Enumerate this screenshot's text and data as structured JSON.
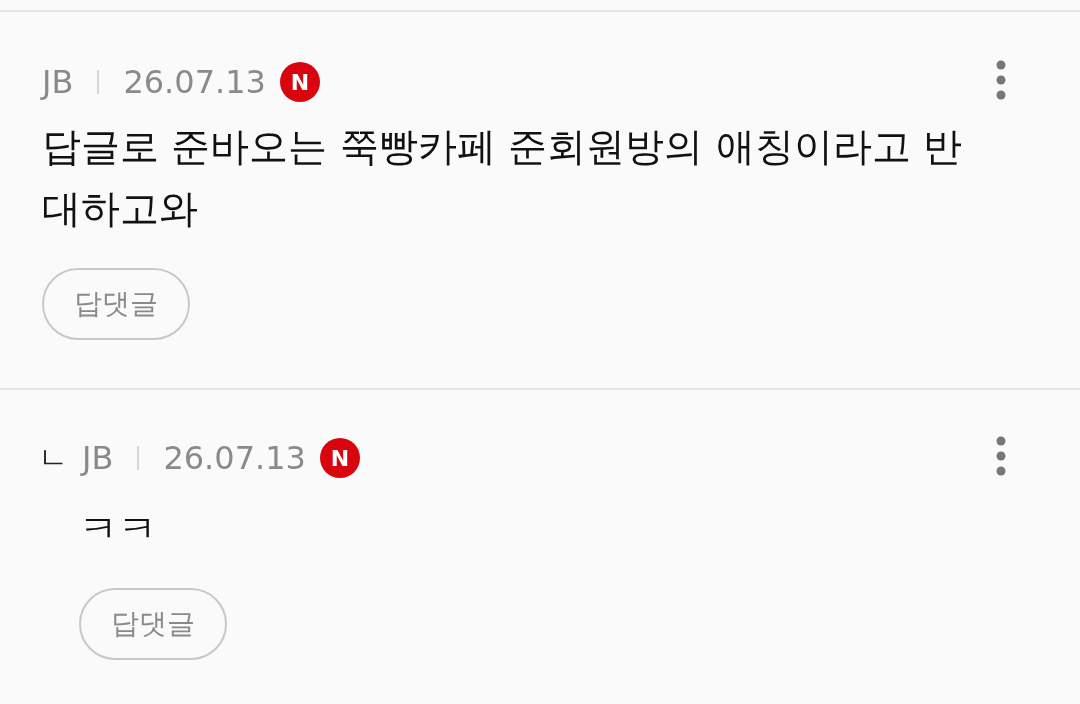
{
  "comments": [
    {
      "kind": "comment",
      "author": "JB",
      "date": "26.07.13",
      "badge": "N",
      "text": "답글로 준바오는 쭉빵카페 준회원방의 애칭이라고 반대하고와",
      "reply_button": "답댓글"
    },
    {
      "kind": "reply",
      "marker": "ㄴ",
      "author": "JB",
      "date": "26.07.13",
      "badge": "N",
      "text": "ㅋㅋ",
      "reply_button": "답댓글"
    }
  ]
}
